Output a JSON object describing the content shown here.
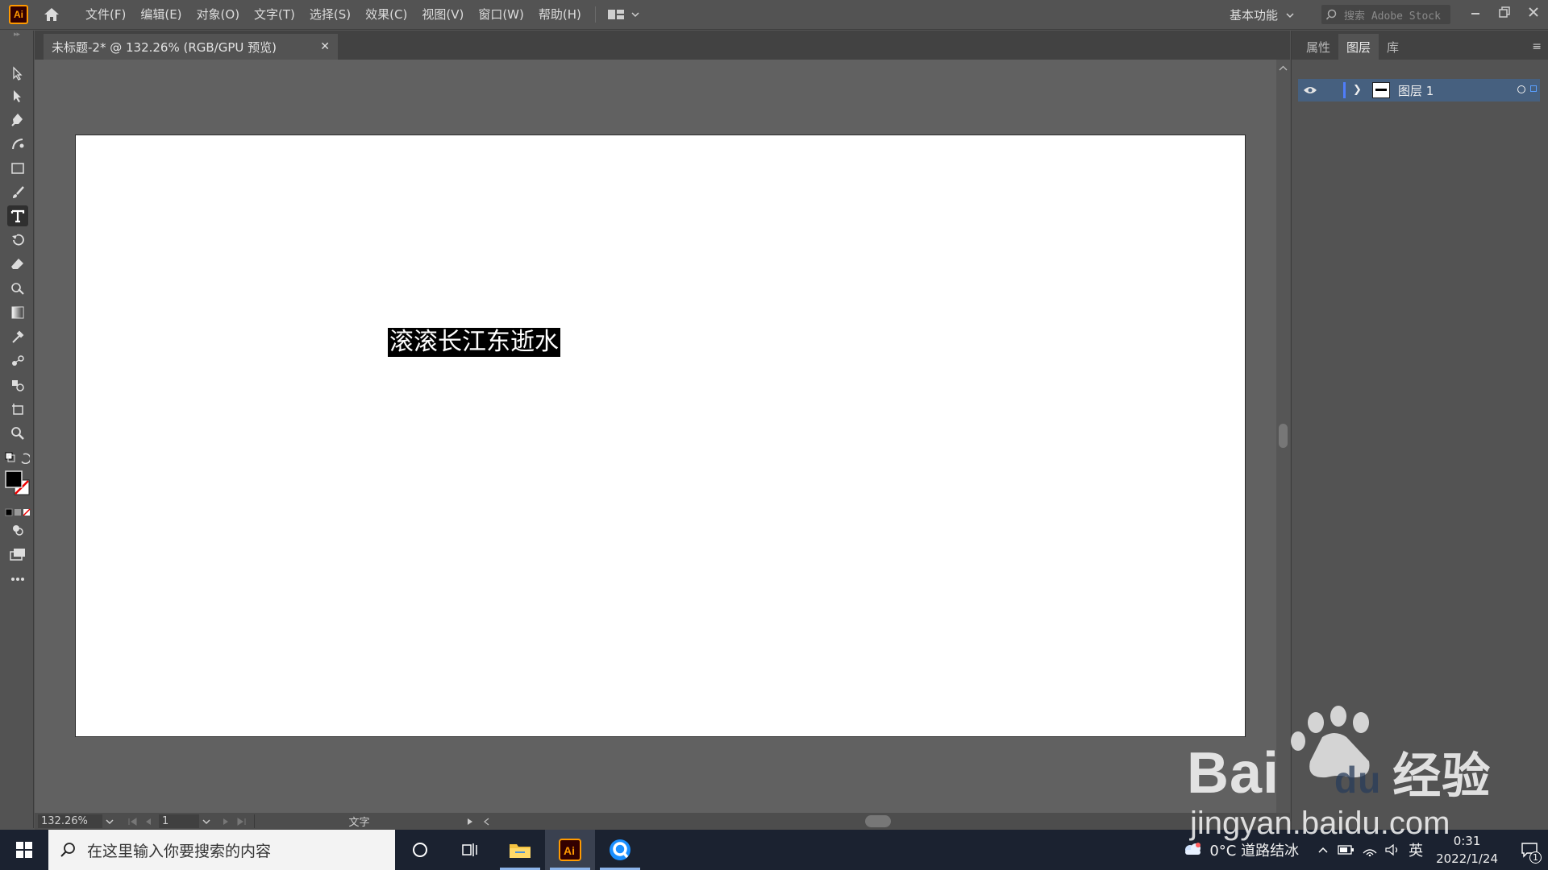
{
  "app": {
    "logo_text": "Ai",
    "menus": [
      "文件(F)",
      "编辑(E)",
      "对象(O)",
      "文字(T)",
      "选择(S)",
      "效果(C)",
      "视图(V)",
      "窗口(W)",
      "帮助(H)"
    ],
    "workspace_label": "基本功能",
    "stock_search_placeholder": "搜索 Adobe Stock"
  },
  "document": {
    "tab_title": "未标题-2* @ 132.26% (RGB/GPU 预览)",
    "canvas_text": "滚滚长江东逝水"
  },
  "status": {
    "zoom": "132.26%",
    "artboard_number": "1",
    "current_tool": "文字"
  },
  "right_panel": {
    "tabs": [
      "属性",
      "图层",
      "库"
    ],
    "active_tab": "图层",
    "layers": [
      {
        "name": "图层 1",
        "color": "#4f7df9"
      }
    ]
  },
  "taskbar": {
    "search_placeholder": "在这里输入你要搜索的内容",
    "weather": "0°C 道路结冰",
    "input_language": "英",
    "time": "0:31",
    "date": "2022/1/24",
    "notifications": "1"
  },
  "watermark": {
    "brand": "Bai",
    "brand_suffix": "du",
    "product": "经验",
    "url": "jingyan.baidu.com"
  },
  "colors": {
    "ui_bg": "#535353",
    "pasteboard": "#616161",
    "accent_orange": "#ff9a00",
    "selection_blue": "#46607f"
  }
}
